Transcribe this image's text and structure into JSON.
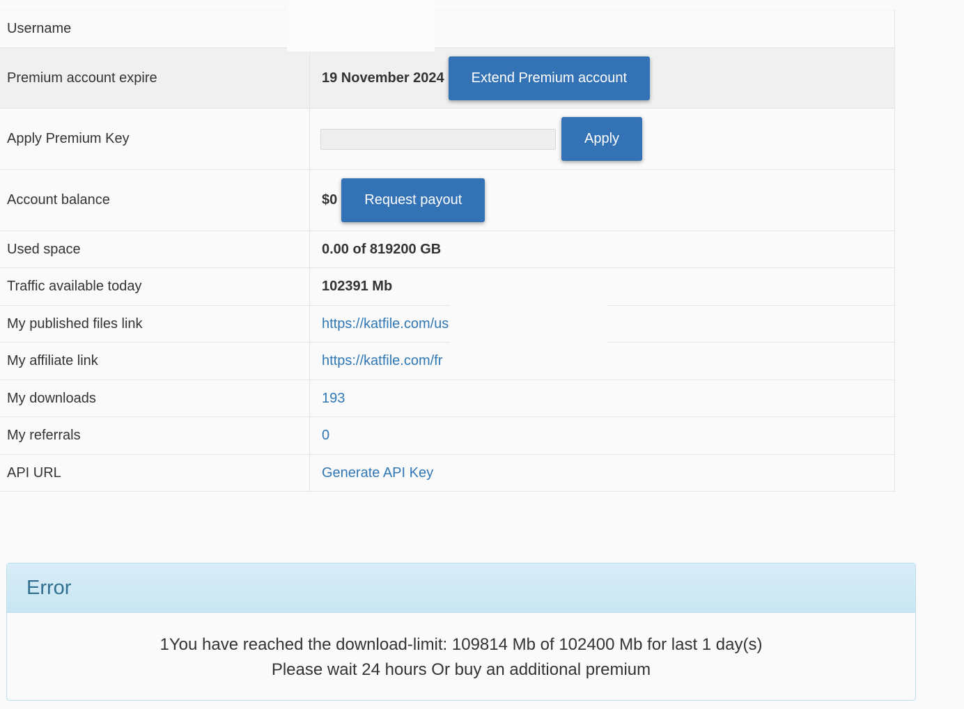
{
  "account": {
    "username_label": "Username",
    "premium_label": "Premium account expire",
    "premium_expire": "19 November 2024",
    "extend_button": "Extend Premium account",
    "apply_key_label": "Apply Premium Key",
    "apply_button": "Apply",
    "balance_label": "Account balance",
    "balance_value": "$0",
    "payout_button": "Request payout",
    "used_space_label": "Used space",
    "used_space_value": "0.00 of 819200 GB",
    "traffic_label": "Traffic available today",
    "traffic_value": "102391 Mb",
    "published_label": "My published files link",
    "published_link": "https://katfile.com/us",
    "affiliate_label": "My affiliate link",
    "affiliate_link": "https://katfile.com/fr",
    "downloads_label": "My downloads",
    "downloads_value": "193",
    "referrals_label": "My referrals",
    "referrals_value": "0",
    "api_label": "API URL",
    "api_link": "Generate API Key"
  },
  "error": {
    "title": "Error",
    "line1": "1You have reached the download-limit: 109814 Mb of 102400 Mb for last 1 day(s)",
    "line2": "Please wait 24 hours Or buy an additional premium"
  },
  "colors": {
    "button": "#3272b5",
    "link": "#2f77b5",
    "alert_header_bg": "#d9edf7",
    "alert_title": "#31708f"
  }
}
